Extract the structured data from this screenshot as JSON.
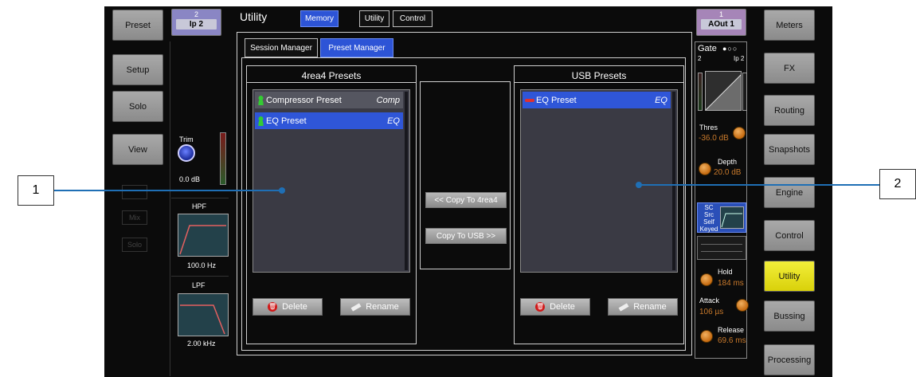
{
  "left_buttons": [
    "Preset",
    "Setup",
    "Solo",
    "View"
  ],
  "right_buttons": [
    "Meters",
    "FX",
    "Routing",
    "Snapshots",
    "Engine",
    "Control",
    "Utility",
    "Bussing",
    "Processing"
  ],
  "active_right_button": "Utility",
  "channel_left": {
    "number": "2",
    "name": "Ip 2"
  },
  "channel_right": {
    "number": "1",
    "name": "AOut 1"
  },
  "left_strip": {
    "trim_label": "Trim",
    "trim_value": "0.0 dB",
    "hpf_label": "HPF",
    "hpf_value": "100.0 Hz",
    "lpf_label": "LPF",
    "lpf_value": "2.00 kHz",
    "ghost_labels": [
      "Mix",
      "Solo"
    ]
  },
  "header": {
    "title": "Utility",
    "tabs": [
      "Memory",
      "Utility",
      "Control"
    ],
    "selected_tab": "Memory"
  },
  "subtabs": {
    "items": [
      "Session Manager",
      "Preset Manager"
    ],
    "selected": "Preset Manager"
  },
  "left_panel": {
    "title": "4rea4 Presets",
    "presets": [
      {
        "name": "Compressor Preset",
        "tag": "Comp",
        "selected": false
      },
      {
        "name": "EQ Preset",
        "tag": "EQ",
        "selected": true
      }
    ],
    "delete_label": "Delete",
    "rename_label": "Rename"
  },
  "right_panel": {
    "title": "USB Presets",
    "presets": [
      {
        "name": "EQ Preset",
        "tag": "EQ",
        "selected": true
      }
    ],
    "delete_label": "Delete",
    "rename_label": "Rename"
  },
  "copy_to_4rea4": "<< Copy To 4rea4",
  "copy_to_usb": "Copy To USB >>",
  "gate": {
    "title": "Gate",
    "in_label": "2",
    "out_label": "Ip 2",
    "thres_label": "Thres",
    "thres_value": "-36.0 dB",
    "depth_label": "Depth",
    "depth_value": "20.0 dB",
    "sc_src_label": "SC Src",
    "sc_src_value1": "Self",
    "sc_src_value2": "Keyed",
    "hold_label": "Hold",
    "hold_value": "184 ms",
    "attack_label": "Attack",
    "attack_value": "106 µs",
    "release_label": "Release",
    "release_value": "69.6 ms"
  },
  "callouts": [
    "1",
    "2"
  ],
  "colors": {
    "accent_blue": "#2f56d8",
    "active_yellow": "#e8e11e",
    "value_orange": "#c8792b",
    "callout_line": "#1f6fb5"
  }
}
